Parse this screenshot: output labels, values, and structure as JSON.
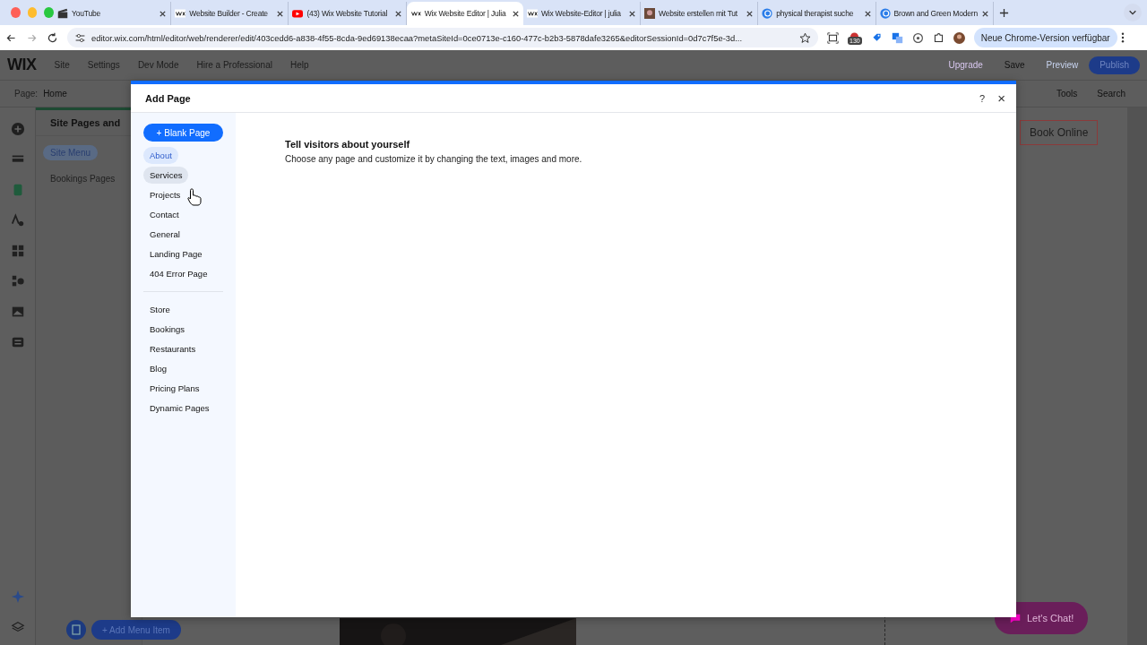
{
  "browser": {
    "tabs": [
      {
        "title": "YouTube",
        "kind": "clapper",
        "selected": false
      },
      {
        "title": "Website Builder - Create",
        "kind": "wix",
        "selected": false
      },
      {
        "title": "(43) Wix Website Tutorial",
        "kind": "youtube",
        "selected": false
      },
      {
        "title": "Wix Website Editor | Julia",
        "kind": "wix",
        "selected": true
      },
      {
        "title": "Wix Website-Editor | julia",
        "kind": "wix",
        "selected": false
      },
      {
        "title": "Website erstellen mit Tut",
        "selected": false
      },
      {
        "title": "physical therapist suche",
        "kind": "globe",
        "selected": false
      },
      {
        "title": "Brown and Green Modern",
        "kind": "globe",
        "selected": false
      }
    ],
    "url": "editor.wix.com/html/editor/web/renderer/edit/403cedd6-a838-4f55-8cda-9ed69138ecaa?metaSiteId=0ce0713e-c160-477c-b2b3-5878dafe3265&editorSessionId=0d7c7f5e-3d...",
    "extension_badge": "130",
    "update_button": "Neue Chrome-Version verfügbar"
  },
  "editor": {
    "logo": "WIX",
    "menu": [
      "Site",
      "Settings",
      "Dev Mode",
      "Hire a Professional",
      "Help"
    ],
    "actions": {
      "upgrade": "Upgrade",
      "save": "Save",
      "preview": "Preview",
      "publish": "Publish"
    },
    "page_label": "Page:",
    "page_value": "Home",
    "tools": "Tools",
    "search": "Search"
  },
  "pages_panel": {
    "title": "Site Pages and",
    "items": [
      {
        "label": "Site Menu",
        "selected": true
      },
      {
        "label": "Bookings Pages",
        "selected": false
      }
    ],
    "add_button": "+ Add Menu Item"
  },
  "canvas": {
    "book_button": "Book Online",
    "chat_button": "Let's Chat!"
  },
  "dialog": {
    "title": "Add Page",
    "help": "?",
    "close": "×",
    "blank_button": "+ Blank Page",
    "groups": [
      {
        "items": [
          {
            "label": "About",
            "selected": true,
            "hovered": false
          },
          {
            "label": "Services",
            "selected": false,
            "hovered": true
          },
          {
            "label": "Projects",
            "selected": false,
            "hovered": false
          },
          {
            "label": "Contact",
            "selected": false,
            "hovered": false
          },
          {
            "label": "General",
            "selected": false,
            "hovered": false
          },
          {
            "label": "Landing Page",
            "selected": false,
            "hovered": false
          },
          {
            "label": "404 Error Page",
            "selected": false,
            "hovered": false
          }
        ]
      },
      {
        "items": [
          {
            "label": "Store",
            "selected": false,
            "hovered": false
          },
          {
            "label": "Bookings",
            "selected": false,
            "hovered": false
          },
          {
            "label": "Restaurants",
            "selected": false,
            "hovered": false
          },
          {
            "label": "Blog",
            "selected": false,
            "hovered": false
          },
          {
            "label": "Pricing Plans",
            "selected": false,
            "hovered": false
          },
          {
            "label": "Dynamic Pages",
            "selected": false,
            "hovered": false
          }
        ]
      }
    ],
    "heading": "Tell visitors about yourself",
    "description": "Choose any page and customize it by changing the text, images and more."
  }
}
